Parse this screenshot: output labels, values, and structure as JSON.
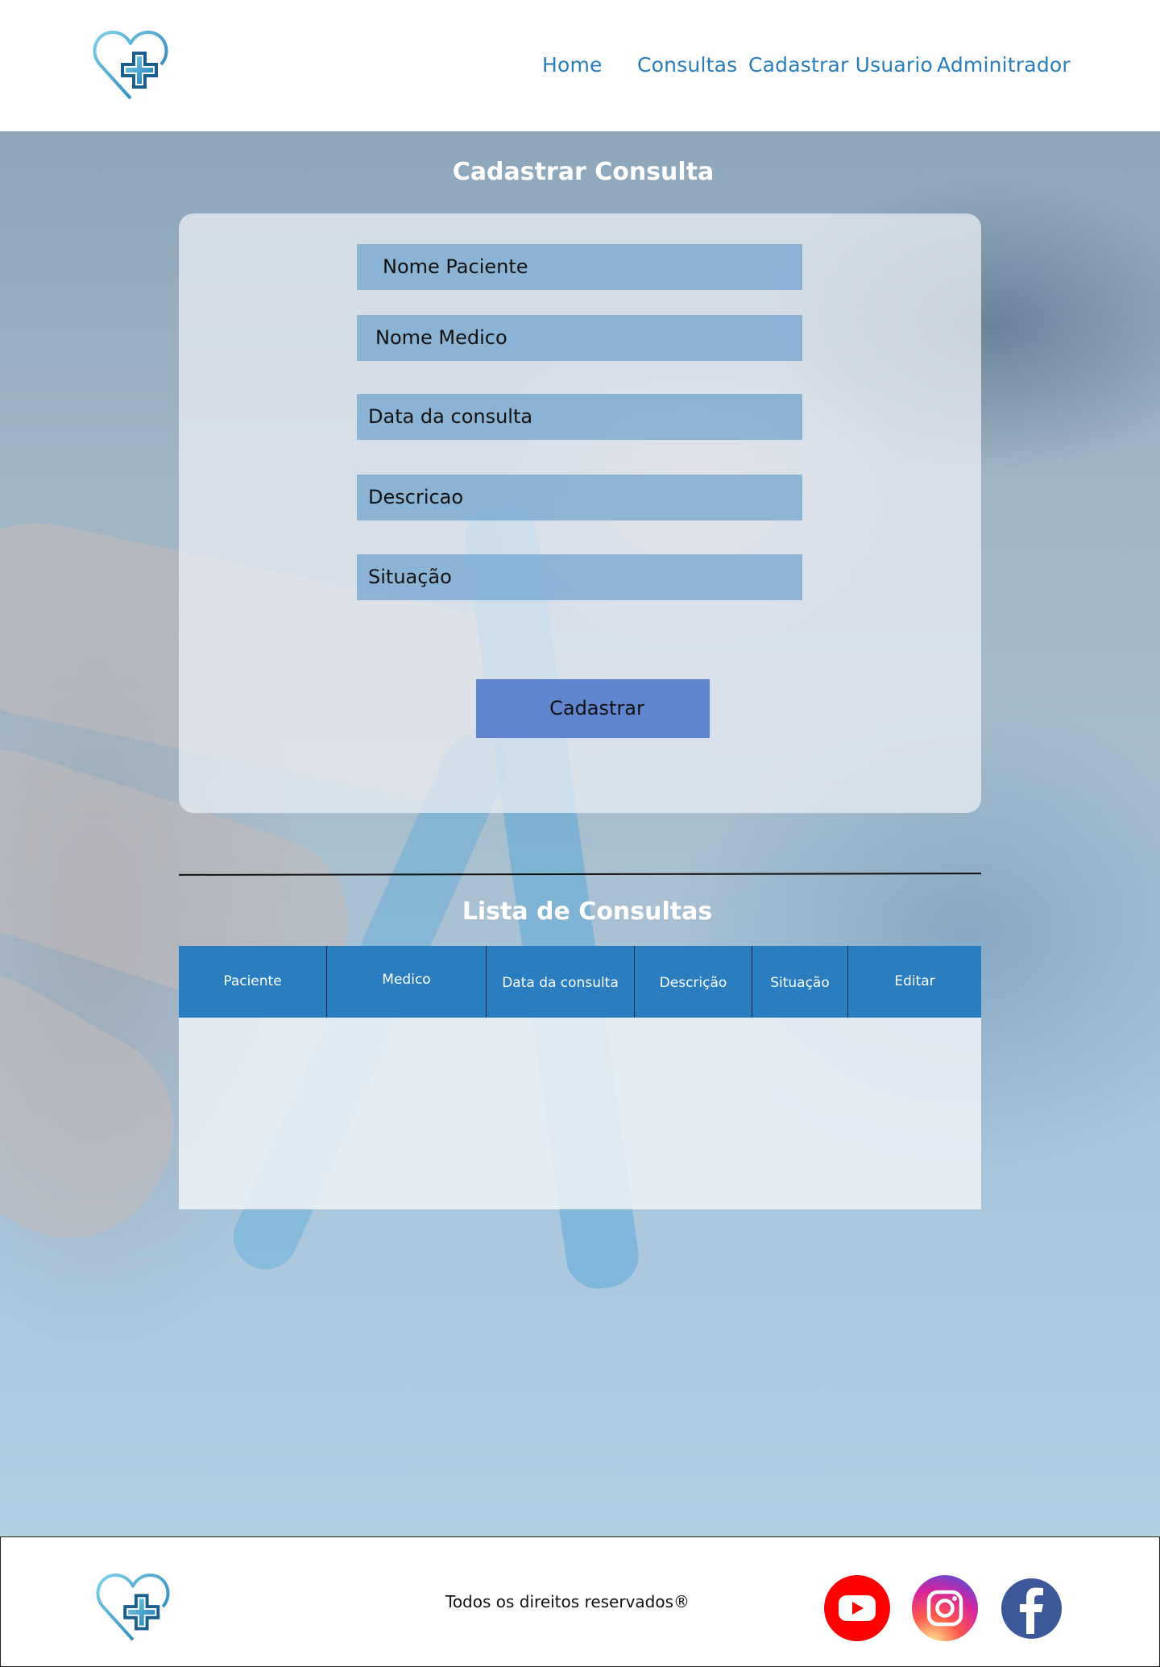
{
  "header": {
    "logo_icon": "heart-plus-icon",
    "nav": [
      {
        "label": "Home"
      },
      {
        "label": "Consultas"
      },
      {
        "label": "Cadastrar Usuario"
      },
      {
        "label": "Adminitrador"
      }
    ]
  },
  "form": {
    "title": "Cadastrar Consulta",
    "fields": [
      {
        "placeholder": "Nome Paciente"
      },
      {
        "placeholder": "Nome Medico"
      },
      {
        "placeholder": "Data da consulta"
      },
      {
        "placeholder": "Descricao"
      },
      {
        "placeholder": "Situação"
      }
    ],
    "submit_label": "Cadastrar"
  },
  "list": {
    "title": "Lista de Consultas",
    "columns": [
      "Paciente",
      "Medico",
      "Data da consulta",
      "Descrição",
      "Situação",
      "Editar"
    ],
    "rows": []
  },
  "footer": {
    "logo_icon": "heart-plus-icon",
    "copyright": "Todos os direitos reservados®",
    "social": [
      {
        "name": "youtube-icon",
        "color": "#ff0000"
      },
      {
        "name": "instagram-icon",
        "color": "#d6249f"
      },
      {
        "name": "facebook-icon",
        "color": "#3b5998"
      }
    ]
  },
  "colors": {
    "accent": "#2a7dbf",
    "button": "#5f86cf",
    "field": "#76a6ce"
  }
}
